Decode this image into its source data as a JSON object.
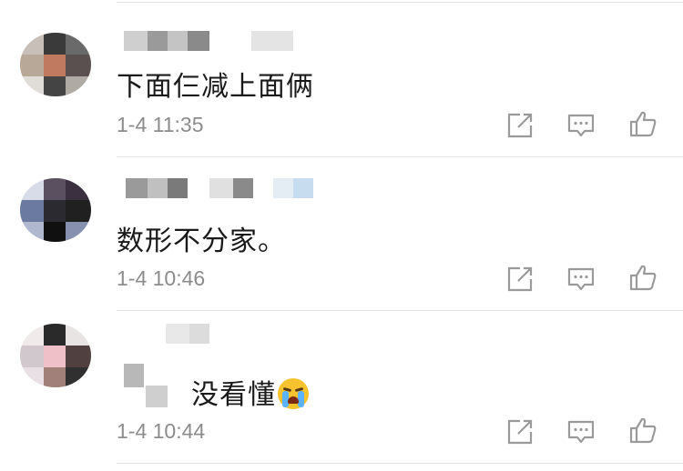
{
  "comments": [
    {
      "text": "下面仨减上面俩",
      "time": "1-4 11:35",
      "avatar_colors": [
        "#9a8a7a",
        "#3a3a3a",
        "#b8a898",
        "#c07a60",
        "#7a6a5a",
        "#444444"
      ]
    },
    {
      "text": "数形不分家。",
      "time": "1-4 10:46",
      "avatar_colors": [
        "#6a7aa0",
        "#3a3040",
        "#b0b8d0",
        "#202020",
        "#404860",
        "#8890b0"
      ]
    },
    {
      "text": "没看懂",
      "time": "1-4 10:44",
      "avatar_colors": [
        "#e0b8c0",
        "#2a2a2a",
        "#f0c8d0",
        "#504040",
        "#a08078",
        "#303030"
      ]
    }
  ],
  "icons": {
    "share": "share-icon",
    "reply": "comment-icon",
    "like": "thumbs-up-icon",
    "emoji": "crying-face-emoji"
  },
  "colors": {
    "text": "#1a1a1a",
    "timestamp": "#8c8c8c",
    "icon": "#9a9a9a",
    "divider": "#e6e6e6"
  }
}
